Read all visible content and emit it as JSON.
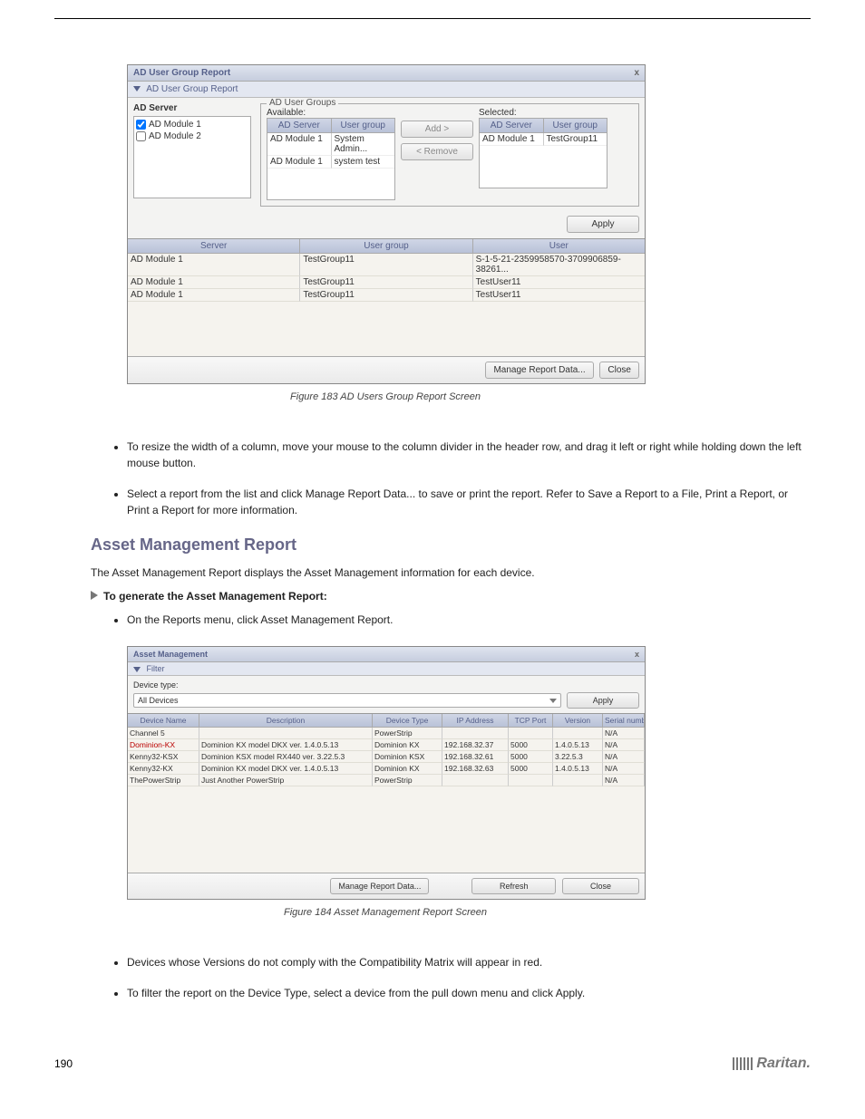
{
  "figure_ref": "Figure 183 AD Users Group Report Screen",
  "dialog1": {
    "title": "AD User Group Report",
    "subtitle": "AD User Group Report",
    "ad_server_heading": "AD Server",
    "servers": [
      "AD Module 1",
      "AD Module 2"
    ],
    "groups_legend": "AD User Groups",
    "available_label": "Available:",
    "selected_label": "Selected:",
    "col_server": "AD Server",
    "col_usergroup": "User group",
    "available_rows": [
      {
        "server": "AD Module 1",
        "group": "System Admin..."
      },
      {
        "server": "AD Module 1",
        "group": "system test"
      }
    ],
    "selected_rows": [
      {
        "server": "AD Module 1",
        "group": "TestGroup11"
      }
    ],
    "btn_add": "Add  >",
    "btn_remove": "<  Remove",
    "btn_apply": "Apply",
    "result_headers": {
      "server": "Server",
      "usergroup": "User group",
      "user": "User"
    },
    "result_rows": [
      {
        "server": "AD Module 1",
        "group": "TestGroup11",
        "user": "S-1-5-21-2359958570-3709906859-38261..."
      },
      {
        "server": "AD Module 1",
        "group": "TestGroup11",
        "user": "TestUser11"
      },
      {
        "server": "AD Module 1",
        "group": "TestGroup11",
        "user": "TestUser11"
      }
    ],
    "btn_manage": "Manage Report Data...",
    "btn_close": "Close"
  },
  "bullets1": [
    "To resize the width of a column, move your mouse to the column divider in the header row, and drag it left or right while holding down the left mouse button.",
    "Select a report from the list and click Manage Report Data... to save or print the report. Refer to Save a Report to a File, Print a Report, or Print a Report for more information."
  ],
  "section2_heading": "Asset Management Report",
  "section2_text": "The Asset Management Report displays the Asset Management information for each device.",
  "arrow_title": "To generate the Asset Management Report:",
  "arrow_step": "On the Reports menu, click Asset Management Report.",
  "figure_ref2": "Figure 184 Asset Management Report Screen",
  "dialog2": {
    "title": "Asset Management",
    "subtitle": "Filter",
    "device_type_label": "Device type:",
    "device_type_value": "All Devices",
    "btn_apply": "Apply",
    "headers": [
      "Device Name",
      "Description",
      "Device Type",
      "IP Address",
      "TCP Port",
      "Version",
      "Serial number"
    ],
    "rows": [
      {
        "name": "Channel 5",
        "desc": "",
        "type": "PowerStrip",
        "ip": "",
        "port": "",
        "ver": "",
        "serial": "N/A"
      },
      {
        "name": "Dominion-KX",
        "desc": "Dominion KX model DKX ver. 1.4.0.5.13",
        "type": "Dominion KX",
        "ip": "192.168.32.37",
        "port": "5000",
        "ver": "1.4.0.5.13",
        "serial": "N/A",
        "red": true
      },
      {
        "name": "Kenny32-KSX",
        "desc": "Dominion KSX model RX440 ver. 3.22.5.3",
        "type": "Dominion KSX",
        "ip": "192.168.32.61",
        "port": "5000",
        "ver": "3.22.5.3",
        "serial": "N/A"
      },
      {
        "name": "Kenny32-KX",
        "desc": "Dominion KX model DKX ver. 1.4.0.5.13",
        "type": "Dominion KX",
        "ip": "192.168.32.63",
        "port": "5000",
        "ver": "1.4.0.5.13",
        "serial": "N/A"
      },
      {
        "name": "ThePowerStrip",
        "desc": "Just Another PowerStrip",
        "type": "PowerStrip",
        "ip": "",
        "port": "",
        "ver": "",
        "serial": "N/A"
      }
    ],
    "btn_manage": "Manage Report Data...",
    "btn_refresh": "Refresh",
    "btn_close": "Close"
  },
  "bullets2": [
    "Devices whose Versions do not comply with the Compatibility Matrix will appear in red.",
    "To filter the report on the Device Type, select a device from the pull down menu and click Apply."
  ],
  "footer_page": "190",
  "footer_brand": "Raritan."
}
